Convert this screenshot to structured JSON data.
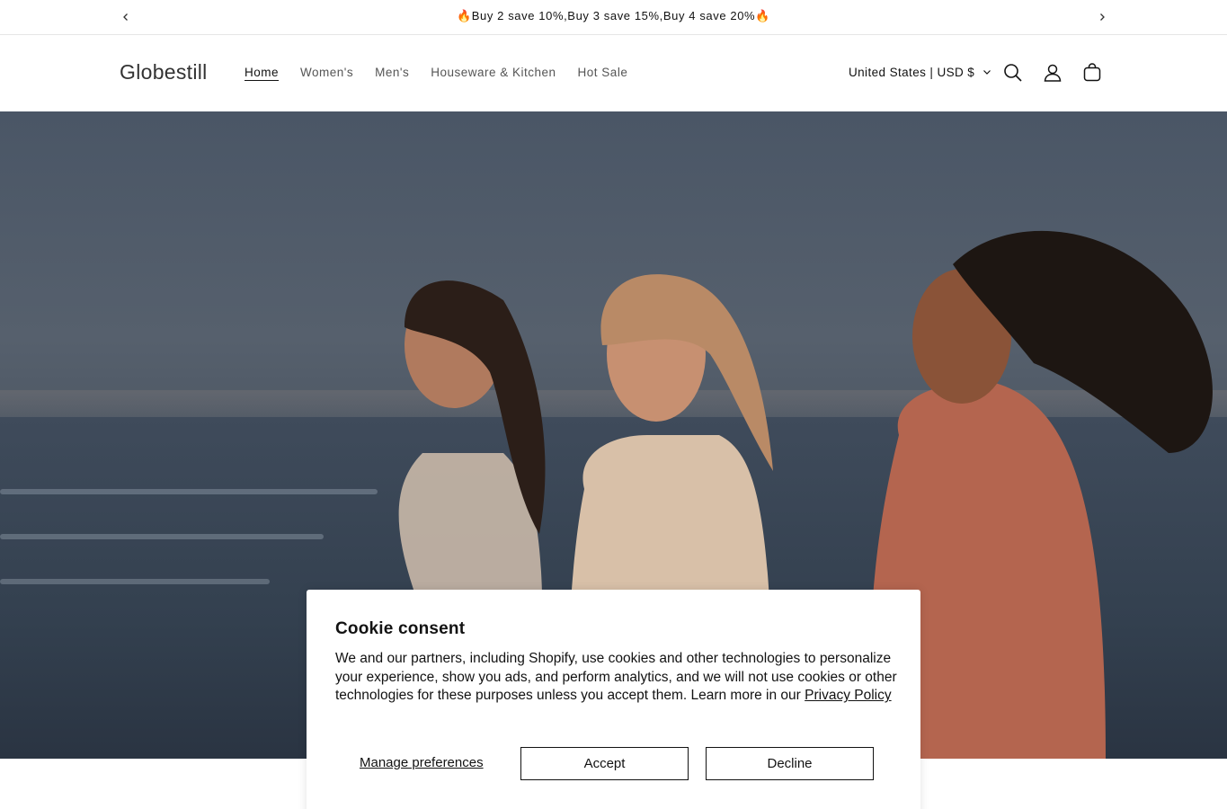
{
  "announcement": {
    "text": "🔥Buy 2 save 10%,Buy 3 save 15%,Buy 4 save 20%🔥",
    "prev_icon": "chevron-left-icon",
    "next_icon": "chevron-right-icon"
  },
  "header": {
    "logo": "Globestill",
    "nav": [
      {
        "label": "Home",
        "active": true
      },
      {
        "label": "Women's"
      },
      {
        "label": "Men's"
      },
      {
        "label": "Houseware & Kitchen"
      },
      {
        "label": "Hot Sale"
      }
    ],
    "locale": "United States | USD $",
    "icons": [
      "search-icon",
      "account-icon",
      "cart-icon"
    ]
  },
  "cookie": {
    "title": "Cookie consent",
    "body": "We and our partners, including Shopify, use cookies and other technologies to personalize your experience, show you ads, and perform analytics, and we will not use cookies or other technologies for these purposes unless you accept them. Learn more in our ",
    "privacy_link": "Privacy Policy",
    "manage_label": "Manage preferences",
    "accept_label": "Accept",
    "decline_label": "Decline"
  }
}
